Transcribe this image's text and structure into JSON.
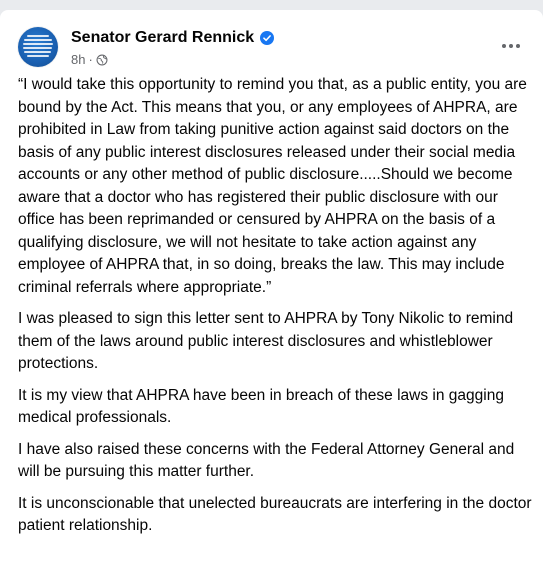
{
  "post": {
    "author": "Senator Gerard Rennick",
    "time": "8h",
    "separator": "·",
    "paragraphs": [
      "“I would take this opportunity to remind you that, as a public entity, you are bound by the Act. This means that you, or any employees of AHPRA, are prohibited in Law from taking punitive action against said doctors on the basis of any public interest disclosures released under their social media accounts or any other method of public disclosure.....Should we become aware that a doctor who has registered their public disclosure with our office has been reprimanded or censured by AHPRA on the basis of a qualifying disclosure, we will not hesitate to take action against any employee of AHPRA that, in so doing, breaks the law. This may include criminal referrals where appropriate.”",
      "I was pleased to sign this letter sent to AHPRA by Tony Nikolic to remind them of the laws around public interest disclosures and whistleblower protections.",
      "It is my view that AHPRA have been in breach of these laws in gagging medical professionals.",
      "I have also raised these concerns with the Federal Attorney General and will be pursuing this matter further.",
      "It is unconscionable that unelected bureaucrats are interfering in the doctor patient relationship."
    ]
  },
  "icons": {
    "verified": "verified-badge-icon",
    "audience": "globe-icon",
    "more": "more-options-icon"
  },
  "colors": {
    "verified": "#1877f2",
    "text": "#050505",
    "secondary": "#65676b"
  }
}
